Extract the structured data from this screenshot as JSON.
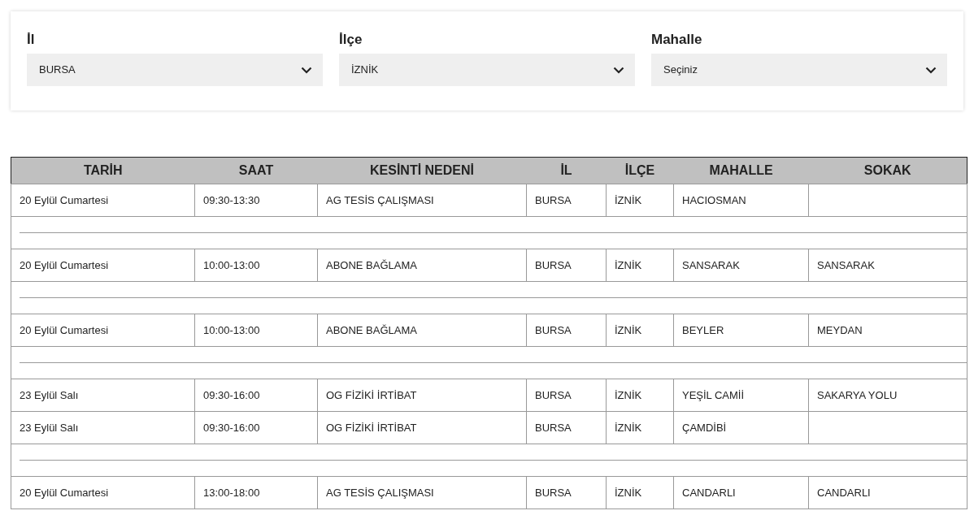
{
  "filters": [
    {
      "label": "İl",
      "value": "BURSA"
    },
    {
      "label": "İlçe",
      "value": "İZNİK"
    },
    {
      "label": "Mahalle",
      "value": "Seçiniz"
    }
  ],
  "table": {
    "columns": [
      "TARİH",
      "SAAT",
      "KESİNTİ NEDENİ",
      "İL",
      "İLÇE",
      "MAHALLE",
      "SOKAK"
    ],
    "rows": [
      {
        "kind": "entry",
        "cells": [
          "20 Eylül Cumartesi",
          "09:30-13:30",
          "AG TESİS ÇALIŞMASI",
          "BURSA",
          "İZNİK",
          "HACIOSMAN",
          ""
        ]
      },
      {
        "kind": "separator"
      },
      {
        "kind": "entry",
        "cells": [
          "20 Eylül Cumartesi",
          "10:00-13:00",
          "ABONE BAĞLAMA",
          "BURSA",
          "İZNİK",
          "SANSARAK",
          "SANSARAK"
        ]
      },
      {
        "kind": "separator"
      },
      {
        "kind": "entry",
        "cells": [
          "20 Eylül Cumartesi",
          "10:00-13:00",
          "ABONE BAĞLAMA",
          "BURSA",
          "İZNİK",
          "BEYLER",
          "MEYDAN"
        ]
      },
      {
        "kind": "separator"
      },
      {
        "kind": "entry",
        "cells": [
          "23 Eylül Salı",
          "09:30-16:00",
          "OG FİZİKİ İRTİBAT",
          "BURSA",
          "İZNİK",
          "YEŞİL CAMİİ",
          "SAKARYA YOLU"
        ]
      },
      {
        "kind": "entry",
        "cells": [
          "23 Eylül Salı",
          "09:30-16:00",
          "OG FİZİKİ İRTİBAT",
          "BURSA",
          "İZNİK",
          "ÇAMDİBİ",
          ""
        ]
      },
      {
        "kind": "separator"
      },
      {
        "kind": "entry",
        "cells": [
          "20 Eylül Cumartesi",
          "13:00-18:00",
          "AG TESİS ÇALIŞMASI",
          "BURSA",
          "İZNİK",
          "CANDARLI",
          "CANDARLI"
        ]
      }
    ]
  }
}
